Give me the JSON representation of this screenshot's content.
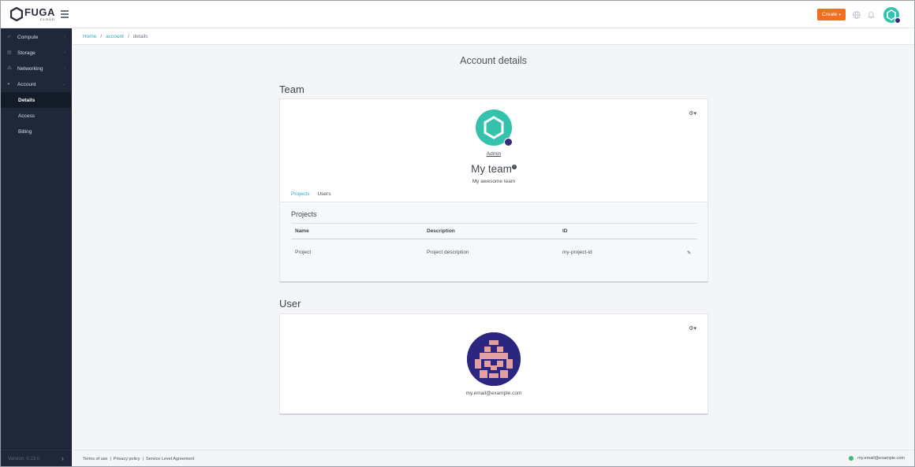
{
  "brand": {
    "name": "FUGA",
    "sub": "CLOUD",
    "accent": "#35c2ad",
    "create_color": "#f26f21",
    "link_color": "#2aa6c6"
  },
  "topbar": {
    "create_label": "Create"
  },
  "sidebar": {
    "items": [
      {
        "label": "Compute",
        "icon": "rocket-icon"
      },
      {
        "label": "Storage",
        "icon": "database-icon"
      },
      {
        "label": "Networking",
        "icon": "network-icon"
      },
      {
        "label": "Account",
        "icon": "user-icon"
      }
    ],
    "sub_items": [
      {
        "label": "Details",
        "active": true
      },
      {
        "label": "Access",
        "active": false
      },
      {
        "label": "Billing",
        "active": false
      }
    ],
    "version": "Version: 0.13.0"
  },
  "breadcrumb": {
    "home": "Home",
    "account": "account",
    "current": "details"
  },
  "page": {
    "title": "Account details"
  },
  "team": {
    "heading": "Team",
    "admin": "Admin",
    "name": "My team",
    "description": "My awesome team",
    "tabs": [
      "Projects",
      "Users"
    ],
    "projects_heading": "Projects",
    "columns": [
      "Name",
      "Description",
      "ID"
    ],
    "rows": [
      {
        "name": "Project",
        "description": "Project description",
        "id": "my-project-id"
      }
    ]
  },
  "user": {
    "heading": "User",
    "email": "my.email@example.com"
  },
  "footer": {
    "terms": "Terms of use",
    "privacy": "Privacy policy",
    "sla": "Service Level Agreement",
    "status_email": "my.email@example.com"
  }
}
